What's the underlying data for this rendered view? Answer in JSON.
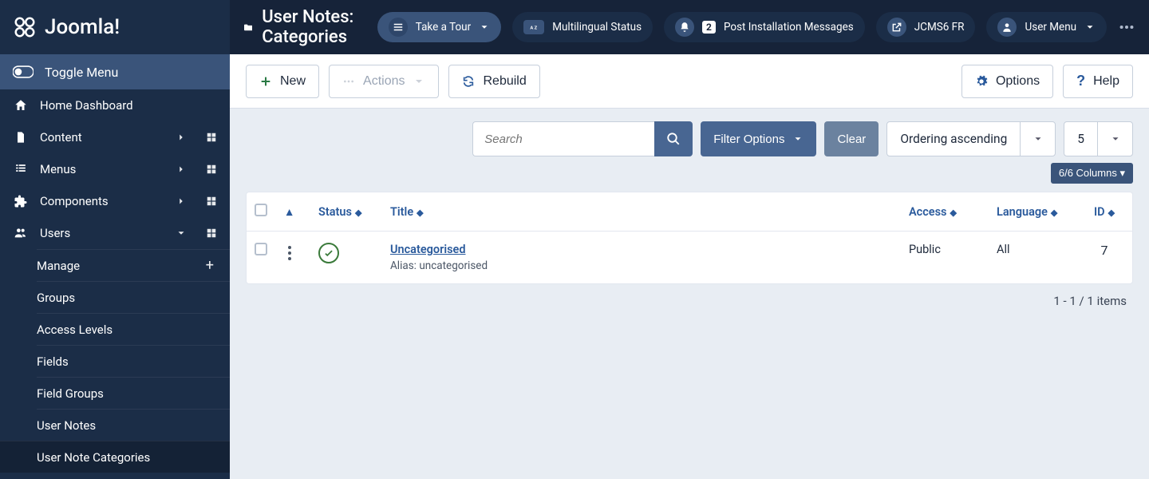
{
  "brand": "Joomla!",
  "toggle_menu": "Toggle Menu",
  "nav": {
    "home": "Home Dashboard",
    "content": "Content",
    "menus": "Menus",
    "components": "Components",
    "users": "Users"
  },
  "nav_sub": {
    "manage": "Manage",
    "groups": "Groups",
    "access": "Access Levels",
    "fields": "Fields",
    "fieldgroups": "Field Groups",
    "usernotes": "User Notes",
    "usernotecats": "User Note Categories"
  },
  "page_title": "User Notes: Categories",
  "header": {
    "tour": "Take a Tour",
    "multilingual": "Multilingual Status",
    "post_install": "Post Installation Messages",
    "post_install_count": "2",
    "site_link": "JCMS6 FR",
    "user_menu": "User Menu"
  },
  "toolbar": {
    "new": "New",
    "actions": "Actions",
    "rebuild": "Rebuild",
    "options": "Options",
    "help": "Help"
  },
  "filters": {
    "search_placeholder": "Search",
    "filter_options": "Filter Options",
    "clear": "Clear",
    "sort": "Ordering ascending",
    "limit": "5"
  },
  "columns_btn": "6/6 Columns",
  "table": {
    "headers": {
      "status": "Status",
      "title": "Title",
      "access": "Access",
      "language": "Language",
      "id": "ID"
    },
    "rows": [
      {
        "title": "Uncategorised",
        "alias_label": "Alias:",
        "alias": "uncategorised",
        "access": "Public",
        "language": "All",
        "id": "7"
      }
    ]
  },
  "pagination": "1 - 1 / 1 items"
}
